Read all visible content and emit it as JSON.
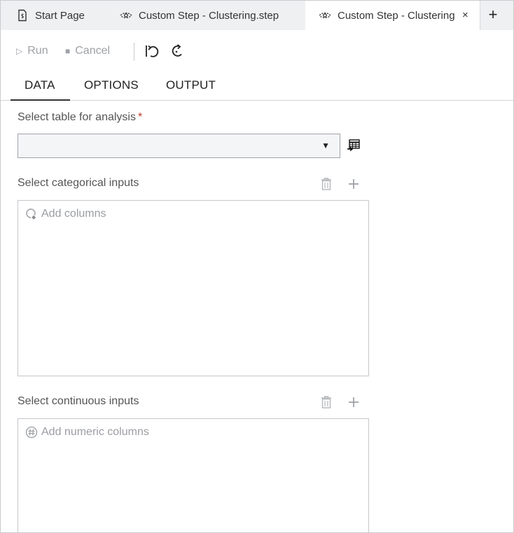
{
  "file_tabs": [
    {
      "label": "Start Page",
      "icon": "start-page-icon"
    },
    {
      "label": "Custom Step - Clustering.step",
      "icon": "custom-step-icon"
    },
    {
      "label": "Custom Step - Clustering",
      "icon": "custom-step-icon",
      "close": "×",
      "active": true
    }
  ],
  "add_tab": "+",
  "toolbar": {
    "run_label": "Run",
    "run_glyph": "▷",
    "cancel_label": "Cancel",
    "cancel_glyph": "■"
  },
  "sub_tabs": [
    "DATA",
    "OPTIONS",
    "OUTPUT"
  ],
  "active_sub_tab": "DATA",
  "data_tab": {
    "table_label": "Select table for analysis",
    "required_mark": "*",
    "table_value": "",
    "dropdown_arrow": "▼",
    "categorical_label": "Select categorical inputs",
    "categorical_placeholder": "Add columns",
    "continuous_label": "Select continuous inputs",
    "continuous_placeholder": "Add numeric columns"
  },
  "colors": {
    "tabstrip_bg": "#eef0f2",
    "required": "#c0392b",
    "disabled_text": "#9ea1a6",
    "placeholder_text": "#9a9da2"
  }
}
